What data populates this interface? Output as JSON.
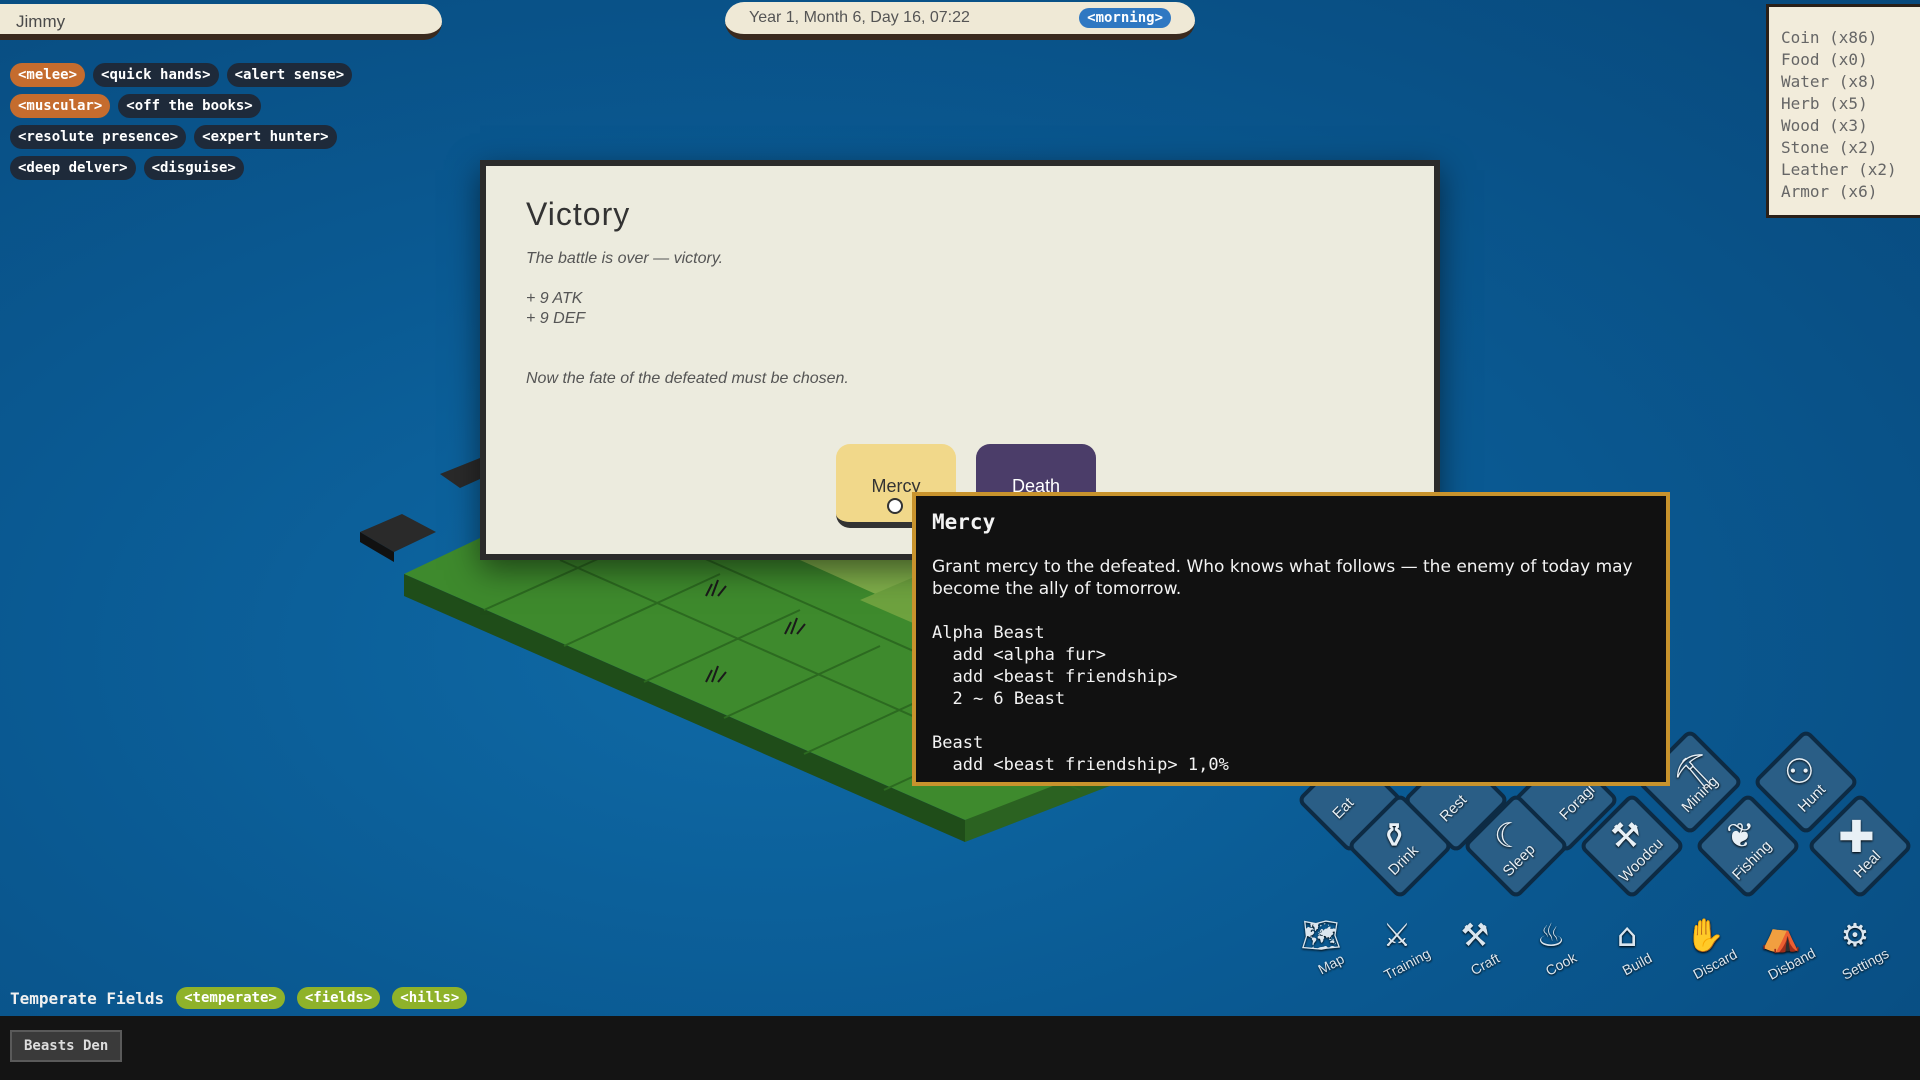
{
  "character": {
    "name": "Jimmy"
  },
  "traits": [
    [
      {
        "label": "<melee>",
        "color": "orange"
      },
      {
        "label": "<quick hands>",
        "color": "dark"
      },
      {
        "label": "<alert sense>",
        "color": "dark"
      }
    ],
    [
      {
        "label": "<muscular>",
        "color": "orange"
      },
      {
        "label": "<off the books>",
        "color": "dark"
      }
    ],
    [
      {
        "label": "<resolute presence>",
        "color": "dark"
      },
      {
        "label": "<expert hunter>",
        "color": "dark"
      }
    ],
    [
      {
        "label": "<deep delver>",
        "color": "dark"
      },
      {
        "label": "<disguise>",
        "color": "dark"
      }
    ]
  ],
  "date": {
    "text": "Year 1, Month 6, Day 16, 07:22",
    "time_of_day": "<morning>"
  },
  "inventory": [
    "Coin (x86)",
    "Food (x0)",
    "Water (x8)",
    "Herb (x5)",
    "Wood (x3)",
    "Stone (x2)",
    "Leather (x2)",
    "Armor (x6)"
  ],
  "dialog": {
    "title": "Victory",
    "summary": "The battle is over — victory.",
    "gains": [
      "+ 9 ATK",
      "+ 9 DEF"
    ],
    "prompt": "Now the fate of the defeated must be chosen.",
    "mercy_label": "Mercy",
    "death_label": "Death"
  },
  "tooltip": {
    "title": "Mercy",
    "description": "Grant mercy to the defeated. Who knows what follows — the enemy of today may become the ally of tomorrow.",
    "lines": [
      "Alpha Beast",
      "  add <alpha fur>",
      "  add <beast friendship>",
      "  2 ~ 6 Beast",
      "",
      "Beast",
      "  add <beast friendship> 1,0%"
    ]
  },
  "actions": {
    "eat": "Eat",
    "rest": "Rest",
    "forage": "Foragi",
    "mining": "Mining",
    "hunt": "Hunt",
    "drink": "Drink",
    "sleep": "Sleep",
    "woodcut": "Woodcu",
    "fishing": "Fishing",
    "heal": "Heal"
  },
  "toolbar": {
    "map": "Map",
    "training": "Training",
    "craft": "Craft",
    "cook": "Cook",
    "build": "Build",
    "discard": "Discard",
    "disband": "Disband",
    "settings": "Settings"
  },
  "region": {
    "name": "Temperate Fields",
    "tags": [
      "<temperate>",
      "<fields>",
      "<hills>"
    ]
  },
  "location_tab": "Beasts Den"
}
